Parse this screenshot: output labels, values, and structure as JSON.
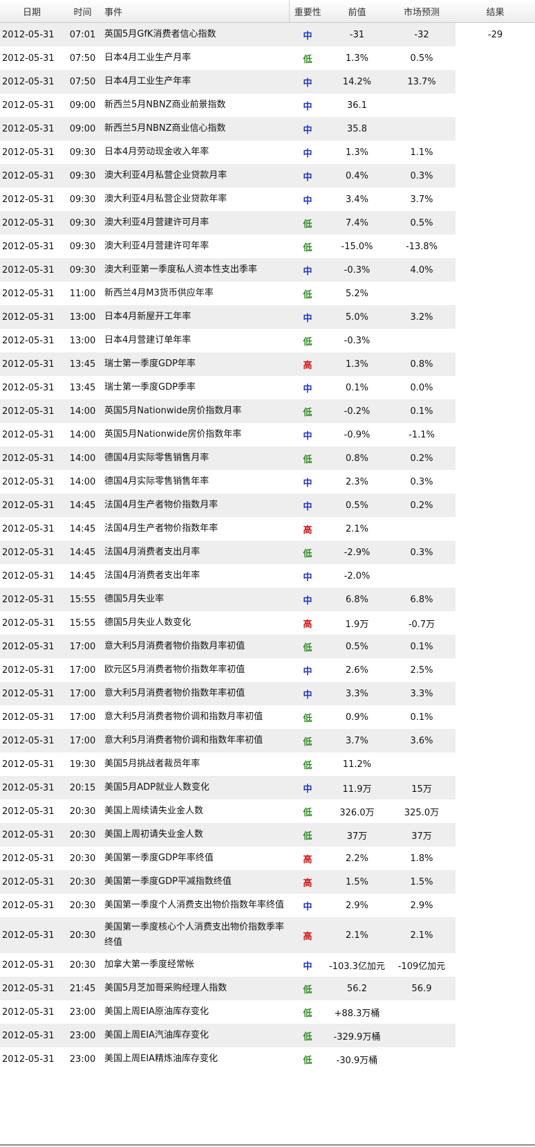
{
  "headers": {
    "date": "日期",
    "time": "时间",
    "event": "事件",
    "importance": "重要性",
    "previous": "前值",
    "forecast": "市场预测",
    "result": "结果"
  },
  "colors": {
    "low": "#2e8b22",
    "mid": "#1f33c4",
    "high": "#d01818"
  },
  "rows": [
    {
      "date": "2012-05-31",
      "time": "07:01",
      "event": "英国5月GfK消费者信心指数",
      "importance": "中",
      "level": "mid",
      "previous": "-31",
      "forecast": "-32",
      "result": "-29"
    },
    {
      "date": "2012-05-31",
      "time": "07:50",
      "event": "日本4月工业生产月率",
      "importance": "低",
      "level": "low",
      "previous": "1.3%",
      "forecast": "0.5%",
      "result": ""
    },
    {
      "date": "2012-05-31",
      "time": "07:50",
      "event": "日本4月工业生产年率",
      "importance": "中",
      "level": "mid",
      "previous": "14.2%",
      "forecast": "13.7%",
      "result": ""
    },
    {
      "date": "2012-05-31",
      "time": "09:00",
      "event": "新西兰5月NBNZ商业前景指数",
      "importance": "中",
      "level": "mid",
      "previous": "36.1",
      "forecast": "",
      "result": ""
    },
    {
      "date": "2012-05-31",
      "time": "09:00",
      "event": "新西兰5月NBNZ商业信心指数",
      "importance": "中",
      "level": "mid",
      "previous": "35.8",
      "forecast": "",
      "result": ""
    },
    {
      "date": "2012-05-31",
      "time": "09:30",
      "event": "日本4月劳动现金收入年率",
      "importance": "中",
      "level": "mid",
      "previous": "1.3%",
      "forecast": "1.1%",
      "result": ""
    },
    {
      "date": "2012-05-31",
      "time": "09:30",
      "event": "澳大利亚4月私营企业贷款月率",
      "importance": "中",
      "level": "mid",
      "previous": "0.4%",
      "forecast": "0.3%",
      "result": ""
    },
    {
      "date": "2012-05-31",
      "time": "09:30",
      "event": "澳大利亚4月私营企业贷款年率",
      "importance": "中",
      "level": "mid",
      "previous": "3.4%",
      "forecast": "3.7%",
      "result": ""
    },
    {
      "date": "2012-05-31",
      "time": "09:30",
      "event": "澳大利亚4月营建许可月率",
      "importance": "低",
      "level": "low",
      "previous": "7.4%",
      "forecast": "0.5%",
      "result": ""
    },
    {
      "date": "2012-05-31",
      "time": "09:30",
      "event": "澳大利亚4月营建许可年率",
      "importance": "低",
      "level": "low",
      "previous": "-15.0%",
      "forecast": "-13.8%",
      "result": ""
    },
    {
      "date": "2012-05-31",
      "time": "09:30",
      "event": "澳大利亚第一季度私人资本性支出季率",
      "importance": "中",
      "level": "mid",
      "previous": "-0.3%",
      "forecast": "4.0%",
      "result": ""
    },
    {
      "date": "2012-05-31",
      "time": "11:00",
      "event": "新西兰4月M3货币供应年率",
      "importance": "低",
      "level": "low",
      "previous": "5.2%",
      "forecast": "",
      "result": ""
    },
    {
      "date": "2012-05-31",
      "time": "13:00",
      "event": "日本4月新屋开工年率",
      "importance": "中",
      "level": "mid",
      "previous": "5.0%",
      "forecast": "3.2%",
      "result": ""
    },
    {
      "date": "2012-05-31",
      "time": "13:00",
      "event": "日本4月营建订单年率",
      "importance": "低",
      "level": "low",
      "previous": "-0.3%",
      "forecast": "",
      "result": ""
    },
    {
      "date": "2012-05-31",
      "time": "13:45",
      "event": "瑞士第一季度GDP年率",
      "importance": "高",
      "level": "high",
      "previous": "1.3%",
      "forecast": "0.8%",
      "result": ""
    },
    {
      "date": "2012-05-31",
      "time": "13:45",
      "event": "瑞士第一季度GDP季率",
      "importance": "中",
      "level": "mid",
      "previous": "0.1%",
      "forecast": "0.0%",
      "result": ""
    },
    {
      "date": "2012-05-31",
      "time": "14:00",
      "event": "英国5月Nationwide房价指数月率",
      "importance": "低",
      "level": "low",
      "previous": "-0.2%",
      "forecast": "0.1%",
      "result": ""
    },
    {
      "date": "2012-05-31",
      "time": "14:00",
      "event": "英国5月Nationwide房价指数年率",
      "importance": "中",
      "level": "mid",
      "previous": "-0.9%",
      "forecast": "-1.1%",
      "result": ""
    },
    {
      "date": "2012-05-31",
      "time": "14:00",
      "event": "德国4月实际零售销售月率",
      "importance": "低",
      "level": "low",
      "previous": "0.8%",
      "forecast": "0.2%",
      "result": ""
    },
    {
      "date": "2012-05-31",
      "time": "14:00",
      "event": "德国4月实际零售销售年率",
      "importance": "中",
      "level": "mid",
      "previous": "2.3%",
      "forecast": "0.3%",
      "result": ""
    },
    {
      "date": "2012-05-31",
      "time": "14:45",
      "event": "法国4月生产者物价指数月率",
      "importance": "中",
      "level": "mid",
      "previous": "0.5%",
      "forecast": "0.2%",
      "result": ""
    },
    {
      "date": "2012-05-31",
      "time": "14:45",
      "event": "法国4月生产者物价指数年率",
      "importance": "高",
      "level": "high",
      "previous": "2.1%",
      "forecast": "",
      "result": ""
    },
    {
      "date": "2012-05-31",
      "time": "14:45",
      "event": "法国4月消费者支出月率",
      "importance": "低",
      "level": "low",
      "previous": "-2.9%",
      "forecast": "0.3%",
      "result": ""
    },
    {
      "date": "2012-05-31",
      "time": "14:45",
      "event": "法国4月消费者支出年率",
      "importance": "中",
      "level": "mid",
      "previous": "-2.0%",
      "forecast": "",
      "result": ""
    },
    {
      "date": "2012-05-31",
      "time": "15:55",
      "event": "德国5月失业率",
      "importance": "中",
      "level": "mid",
      "previous": "6.8%",
      "forecast": "6.8%",
      "result": ""
    },
    {
      "date": "2012-05-31",
      "time": "15:55",
      "event": "德国5月失业人数变化",
      "importance": "高",
      "level": "high",
      "previous": "1.9万",
      "forecast": "-0.7万",
      "result": ""
    },
    {
      "date": "2012-05-31",
      "time": "17:00",
      "event": "意大利5月消费者物价指数月率初值",
      "importance": "低",
      "level": "low",
      "previous": "0.5%",
      "forecast": "0.1%",
      "result": ""
    },
    {
      "date": "2012-05-31",
      "time": "17:00",
      "event": "欧元区5月消费者物价指数年率初值",
      "importance": "中",
      "level": "mid",
      "previous": "2.6%",
      "forecast": "2.5%",
      "result": ""
    },
    {
      "date": "2012-05-31",
      "time": "17:00",
      "event": "意大利5月消费者物价指数年率初值",
      "importance": "中",
      "level": "mid",
      "previous": "3.3%",
      "forecast": "3.3%",
      "result": ""
    },
    {
      "date": "2012-05-31",
      "time": "17:00",
      "event": "意大利5月消费者物价调和指数月率初值",
      "importance": "低",
      "level": "low",
      "previous": "0.9%",
      "forecast": "0.1%",
      "result": ""
    },
    {
      "date": "2012-05-31",
      "time": "17:00",
      "event": "意大利5月消费者物价调和指数年率初值",
      "importance": "低",
      "level": "low",
      "previous": "3.7%",
      "forecast": "3.6%",
      "result": ""
    },
    {
      "date": "2012-05-31",
      "time": "19:30",
      "event": "美国5月挑战者裁员年率",
      "importance": "低",
      "level": "low",
      "previous": "11.2%",
      "forecast": "",
      "result": ""
    },
    {
      "date": "2012-05-31",
      "time": "20:15",
      "event": "美国5月ADP就业人数变化",
      "importance": "中",
      "level": "mid",
      "previous": "11.9万",
      "forecast": "15万",
      "result": ""
    },
    {
      "date": "2012-05-31",
      "time": "20:30",
      "event": "美国上周续请失业金人数",
      "importance": "低",
      "level": "low",
      "previous": "326.0万",
      "forecast": "325.0万",
      "result": ""
    },
    {
      "date": "2012-05-31",
      "time": "20:30",
      "event": "美国上周初请失业金人数",
      "importance": "低",
      "level": "low",
      "previous": "37万",
      "forecast": "37万",
      "result": ""
    },
    {
      "date": "2012-05-31",
      "time": "20:30",
      "event": "美国第一季度GDP年率终值",
      "importance": "高",
      "level": "high",
      "previous": "2.2%",
      "forecast": "1.8%",
      "result": ""
    },
    {
      "date": "2012-05-31",
      "time": "20:30",
      "event": "美国第一季度GDP平减指数终值",
      "importance": "高",
      "level": "high",
      "previous": "1.5%",
      "forecast": "1.5%",
      "result": ""
    },
    {
      "date": "2012-05-31",
      "time": "20:30",
      "event": "美国第一季度个人消费支出物价指数年率终值",
      "importance": "中",
      "level": "mid",
      "previous": "2.9%",
      "forecast": "2.9%",
      "result": ""
    },
    {
      "date": "2012-05-31",
      "time": "20:30",
      "event": "美国第一季度核心个人消费支出物价指数季率终值",
      "importance": "高",
      "level": "high",
      "previous": "2.1%",
      "forecast": "2.1%",
      "result": "",
      "tall": true
    },
    {
      "date": "2012-05-31",
      "time": "20:30",
      "event": "加拿大第一季度经常帐",
      "importance": "中",
      "level": "mid",
      "previous": "-103.3亿加元",
      "forecast": "-109亿加元",
      "result": ""
    },
    {
      "date": "2012-05-31",
      "time": "21:45",
      "event": "美国5月芝加哥采购经理人指数",
      "importance": "低",
      "level": "low",
      "previous": "56.2",
      "forecast": "56.9",
      "result": ""
    },
    {
      "date": "2012-05-31",
      "time": "23:00",
      "event": "美国上周EIA原油库存变化",
      "importance": "低",
      "level": "low",
      "previous": "+88.3万桶",
      "forecast": "",
      "result": ""
    },
    {
      "date": "2012-05-31",
      "time": "23:00",
      "event": "美国上周EIA汽油库存变化",
      "importance": "低",
      "level": "low",
      "previous": "-329.9万桶",
      "forecast": "",
      "result": ""
    },
    {
      "date": "2012-05-31",
      "time": "23:00",
      "event": "美国上周EIA精炼油库存变化",
      "importance": "低",
      "level": "low",
      "previous": "-30.9万桶",
      "forecast": "",
      "result": ""
    }
  ]
}
